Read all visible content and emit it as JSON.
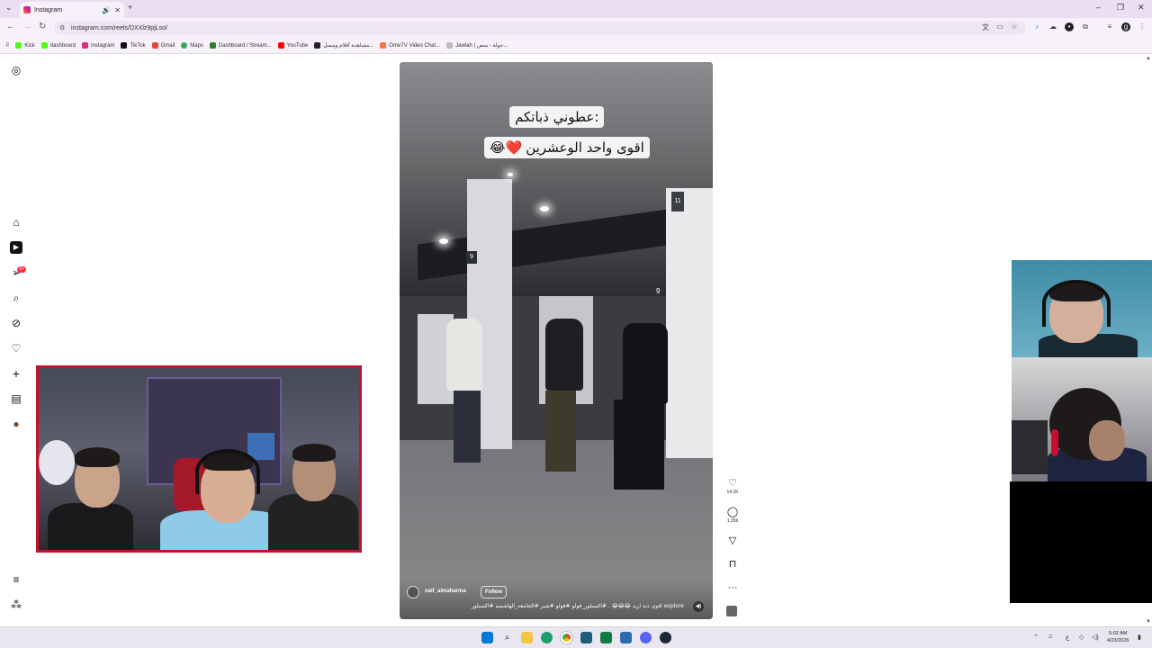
{
  "browser": {
    "tab_title": "Instagram",
    "url": "instagram.com/reels/DXXlz9pjLso/",
    "bookmarks": [
      {
        "label": "Kick",
        "color": "#53fc18"
      },
      {
        "label": "dashboard",
        "color": "#53fc18"
      },
      {
        "label": "instagram",
        "color": "#dd2a7b"
      },
      {
        "label": "TikTok",
        "color": "#111111"
      },
      {
        "label": "Gmail",
        "color": "#ea4335"
      },
      {
        "label": "Maps",
        "color": "#34a853"
      },
      {
        "label": "Dashboard / Stream...",
        "color": "#2e7d32"
      },
      {
        "label": "YouTube",
        "color": "#ff0000"
      },
      {
        "label": "مشاهدة أفلام ومسل...",
        "color": "#222222"
      },
      {
        "label": "OmeTV Video Chat...",
        "color": "#ff7043"
      },
      {
        "label": "Jawlah | جولة - منص...",
        "color": "#9e9e9e"
      }
    ]
  },
  "sidebar": {
    "items": [
      {
        "name": "instagram-logo-icon",
        "glyph": "◎"
      },
      {
        "name": "home-icon",
        "glyph": "⌂"
      },
      {
        "name": "reels-icon",
        "glyph": "▶"
      },
      {
        "name": "messages-icon",
        "glyph": "➢"
      },
      {
        "name": "search-icon",
        "glyph": "⌕"
      },
      {
        "name": "explore-icon",
        "glyph": "⊘"
      },
      {
        "name": "notifications-icon",
        "glyph": "♡"
      },
      {
        "name": "create-icon",
        "glyph": "+"
      },
      {
        "name": "dashboard-icon",
        "glyph": "▤"
      },
      {
        "name": "profile-avatar",
        "glyph": "●"
      },
      {
        "name": "more-menu-icon",
        "glyph": "≡"
      },
      {
        "name": "meta-apps-icon",
        "glyph": "⁂"
      }
    ],
    "messages_badge": "9+"
  },
  "reel": {
    "caption_line1": "عطوني ذباتكم:",
    "caption_line2": "اقوى واحد الوعشرين",
    "caption_emoji": "😂❤️",
    "username": "naif_almaharma",
    "follow_label": "Follow",
    "description": "اقوى ذبه اريد 😂😂😂 . #اكسبلور_فولو #فولو #شير #الجامعه_الهاشميه #اكسبلور explore",
    "pump_number_left": "9",
    "pump_number_right": "9",
    "pillar_sign": "11"
  },
  "actions": {
    "likes": "14.1K",
    "comments": "1,156"
  },
  "taskbar": {
    "time": "5:02 AM",
    "date": "4/23/2026",
    "lang": "ع"
  },
  "colors": {
    "titlebar": "#e9dff0",
    "accent_red": "#c8102e",
    "badge": "#ff3040"
  }
}
